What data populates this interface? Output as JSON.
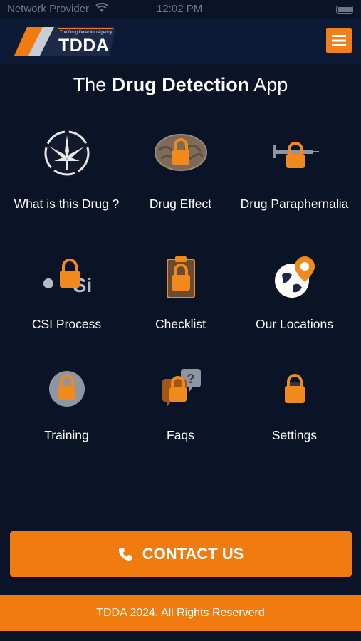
{
  "status_bar": {
    "carrier": "Network Provider",
    "time": "12:02 PM"
  },
  "header": {
    "logo_tagline": "The Drug Detection Agency",
    "logo_brand": "TDDA",
    "menu_icon": "hamburger-menu-icon"
  },
  "title": {
    "prefix": "The",
    "bold": "Drug Detection",
    "suffix": "App"
  },
  "tiles": [
    {
      "label": "What is this Drug ?",
      "icon": "cannabis-leaf-icon",
      "locked": false
    },
    {
      "label": "Drug Effect",
      "icon": "brain-icon",
      "locked": true
    },
    {
      "label": "Drug Paraphernalia",
      "icon": "syringe-icon",
      "locked": true
    },
    {
      "label": "CSI Process",
      "icon": "csi-icon",
      "locked": true
    },
    {
      "label": "Checklist",
      "icon": "clipboard-icon",
      "locked": true
    },
    {
      "label": "Our Locations",
      "icon": "globe-location-icon",
      "locked": false
    },
    {
      "label": "Training",
      "icon": "training-icon",
      "locked": true
    },
    {
      "label": "Faqs",
      "icon": "faq-chat-icon",
      "locked": true
    },
    {
      "label": "Settings",
      "icon": "settings-icon",
      "locked": true
    }
  ],
  "contact": {
    "label": "CONTACT US",
    "icon": "phone-icon"
  },
  "footer": {
    "text": "TDDA 2024, All Rights Reserverd"
  },
  "colors": {
    "background": "#0b1426",
    "accent": "#f07b0f",
    "header": "#0c1a36"
  }
}
